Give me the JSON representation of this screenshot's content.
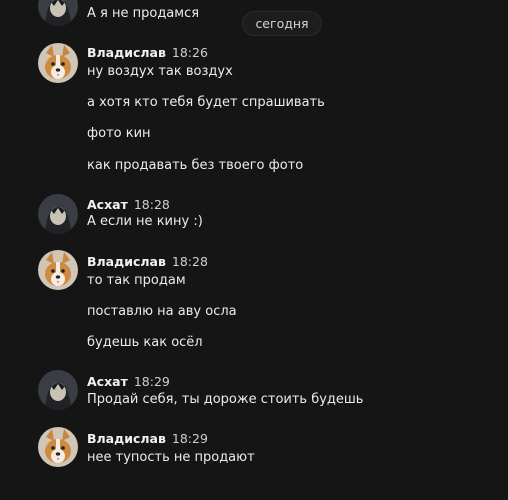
{
  "date_divider": "сегодня",
  "prev_message": "А я не продамся",
  "groups": [
    {
      "author": "Владислав",
      "time": "18:26",
      "lines": [
        "ну воздух так воздух",
        "а хотя кто тебя будет спрашивать",
        "фото кин",
        "как продавать без твоего фото"
      ]
    },
    {
      "author": "Асхат",
      "time": "18:28",
      "lines": [
        "А если не кину :)"
      ]
    },
    {
      "author": "Владислав",
      "time": "18:28",
      "lines": [
        "то так продам",
        "поставлю на аву осла",
        "будешь как осёл"
      ]
    },
    {
      "author": "Асхат",
      "time": "18:29",
      "lines": [
        "Продай себя, ты дороже стоить будешь"
      ]
    },
    {
      "author": "Владислав",
      "time": "18:29",
      "lines": [
        "нее тупость не продают"
      ]
    }
  ]
}
